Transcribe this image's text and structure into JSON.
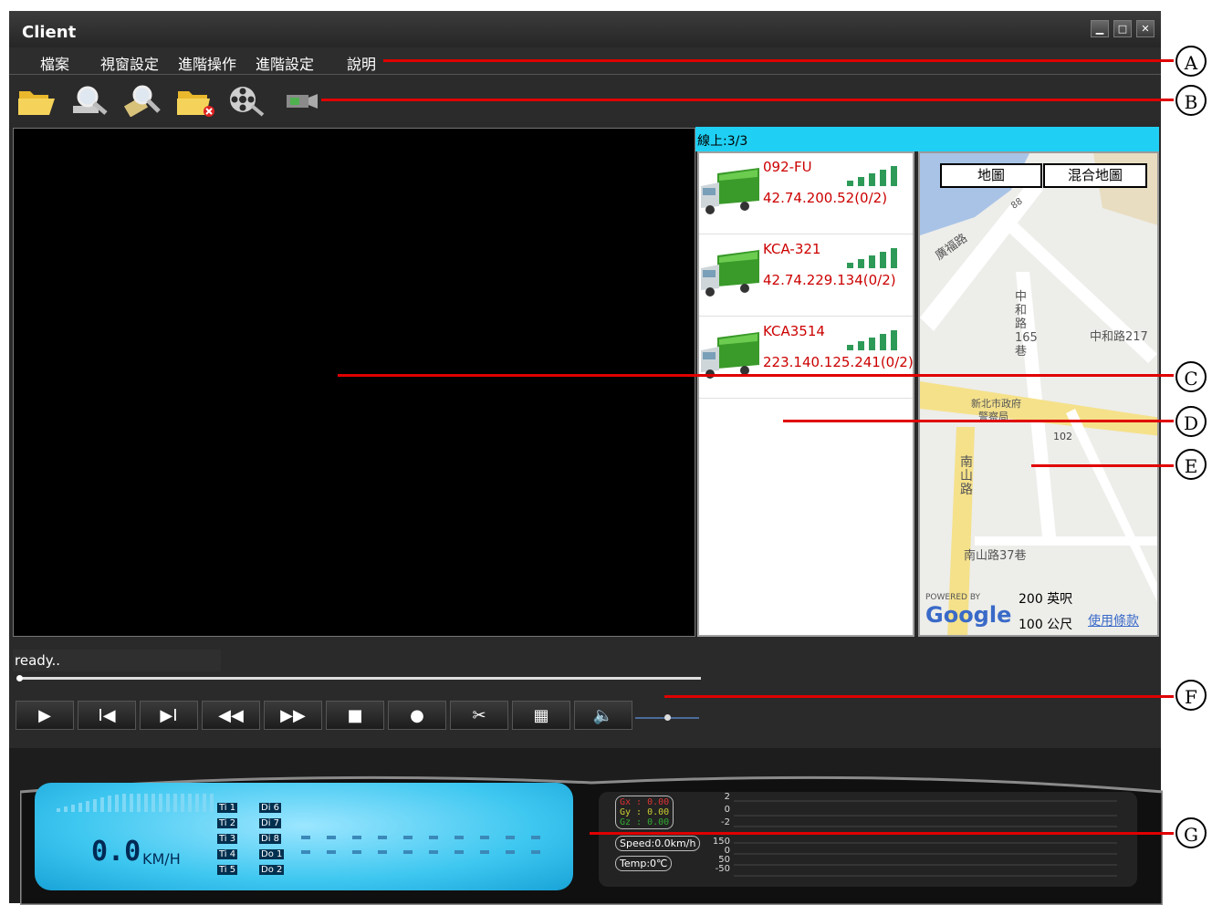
{
  "window": {
    "title": "Client",
    "controls": [
      "minimize",
      "maximize",
      "close"
    ]
  },
  "menu": [
    "檔案",
    "視窗設定",
    "進階操作",
    "進階設定",
    "說明"
  ],
  "toolbar": {
    "icons": [
      "open-folder-icon",
      "search-icon",
      "search-settings-icon",
      "close-folder-icon",
      "film-reel-icon",
      "camera-icon"
    ]
  },
  "vehicles": {
    "online_label": "線上:3/3",
    "items": [
      {
        "name": "092-FU",
        "ip": "42.74.200.52(0/2)"
      },
      {
        "name": "KCA-321",
        "ip": "42.74.229.134(0/2)"
      },
      {
        "name": "KCA3514",
        "ip": "223.140.125.241(0/2)"
      }
    ]
  },
  "map": {
    "tab_map": "地圖",
    "tab_hybrid": "混合地圖",
    "labels": [
      "廣福路",
      "中和路165巷",
      "中和路217",
      "新北市政府",
      "警察局",
      "102",
      "南山路",
      "南山路37巷",
      "88"
    ],
    "scale_ft": "200 英呎",
    "scale_m": "100 公尺",
    "powered_by": "POWERED BY",
    "google": "Google",
    "terms": "使用條款"
  },
  "status": {
    "text": "ready.."
  },
  "player": {
    "buttons": [
      "▶",
      "I◀",
      "▶I",
      "◀◀",
      "▶▶",
      "■",
      "●",
      "✂",
      "▦",
      "🔈"
    ]
  },
  "dashboard": {
    "speed": "0.0",
    "unit": "KM/H",
    "inputs_left": [
      "Ti 1",
      "Ti 2",
      "Ti 3",
      "Ti 4",
      "Ti 5"
    ],
    "inputs_right": [
      "Di 6",
      "Di 7",
      "Di 8",
      "Do 1",
      "Do 2"
    ],
    "g_values": [
      "Gx : 0.00",
      "Gy : 0.00",
      "Gz : 0.00"
    ],
    "speed_small": "Speed:0.0km/h",
    "temp": "Temp:0℃",
    "g_scale": [
      "2",
      "0",
      "-2"
    ],
    "t_scale": [
      "150",
      "0",
      "50",
      "-50"
    ]
  },
  "callouts": [
    "A",
    "B",
    "C",
    "D",
    "E",
    "F",
    "G"
  ],
  "colors": {
    "accent": "#1fd0f4",
    "vehicle_text": "#cc0000",
    "callout_line": "#e00000"
  }
}
